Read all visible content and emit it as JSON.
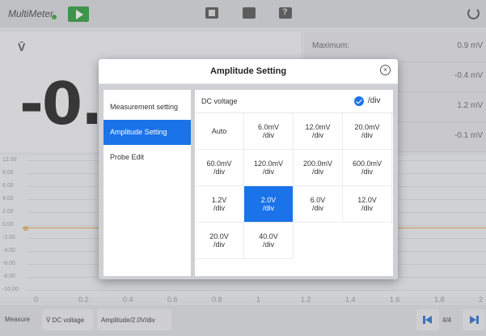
{
  "app": {
    "title": "MultiMeter"
  },
  "readout": {
    "unit_symbol": "V̄",
    "value": "-0."
  },
  "stats": [
    {
      "label": "Maximum:",
      "value": "0.9 mV"
    },
    {
      "label": "",
      "value": "-0.4 mV"
    },
    {
      "label": "",
      "value": "1.2 mV"
    },
    {
      "label": "",
      "value": "-0.1 mV"
    }
  ],
  "graph": {
    "y_ticks": [
      "12.00",
      "8.00",
      "6.00",
      "4.00",
      "2.00",
      "0.00",
      "-2.00",
      "-4.00",
      "-6.00",
      "-8.00",
      "-10.00"
    ],
    "x_ticks": [
      "0",
      "0.2",
      "0.4",
      "0.6",
      "0.8",
      "1",
      "1.2",
      "1.4",
      "1.6",
      "1.8",
      "2"
    ]
  },
  "bottom": {
    "measure_label": "Measure",
    "mode_chip": "V̄ DC voltage",
    "amplitude_chip": "Amplitude/2.0V/div",
    "page": "4/4"
  },
  "dialog": {
    "title": "Amplitude Setting",
    "menu": [
      "Measurement setting",
      "Amplitude Setting",
      "Probe Edit"
    ],
    "active_menu": 1,
    "selected_mode": "DC voltage",
    "unit": "/div",
    "options": [
      "Auto",
      "6.0mV\n/div",
      "12.0mV\n/div",
      "20.0mV\n/div",
      "60.0mV\n/div",
      "120.0mV\n/div",
      "200.0mV\n/div",
      "600.0mV\n/div",
      "1.2V\n/div",
      "2.0V\n/div",
      "6.0V\n/div",
      "12.0V\n/div",
      "20.0V\n/div",
      "40.0V\n/div"
    ],
    "selected_option": 9
  },
  "colors": {
    "accent": "#1a73e8",
    "play": "#2c9e3c",
    "zero_line": "#e6a64b"
  }
}
